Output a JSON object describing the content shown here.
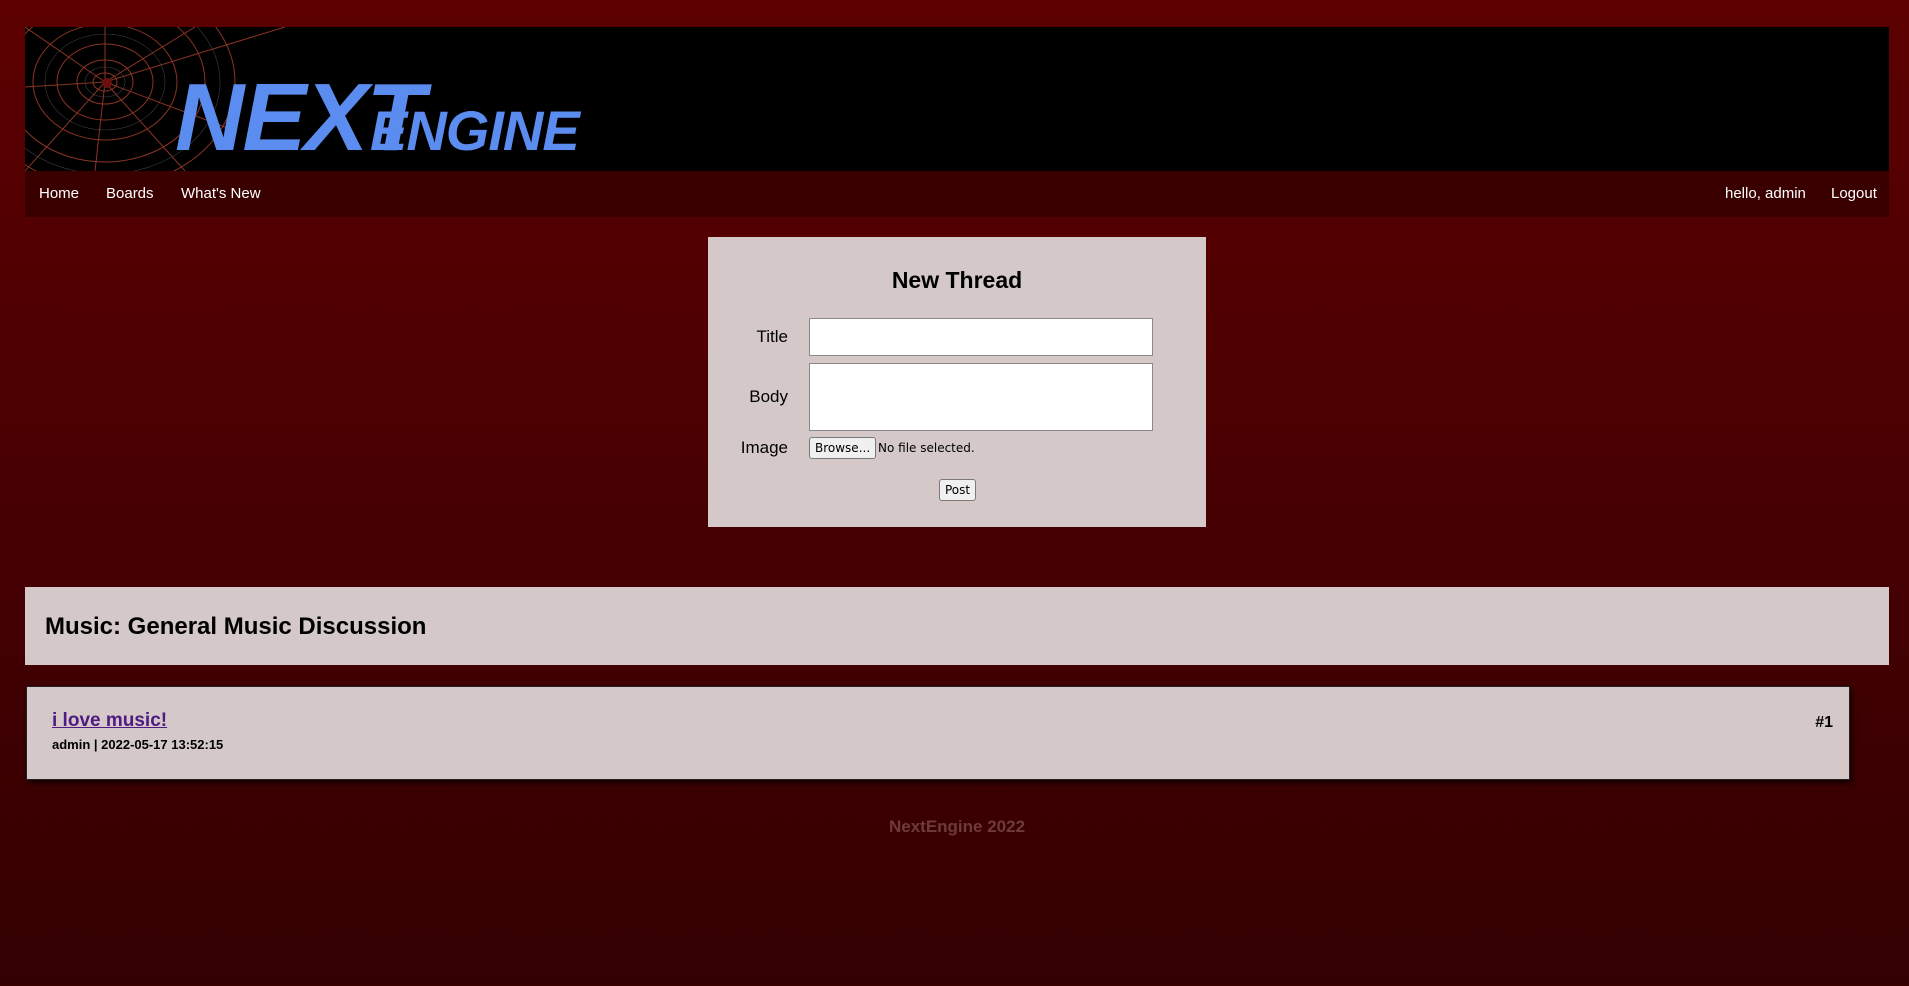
{
  "banner": {
    "logo_text_big": "NEXT",
    "logo_text_small": "ENGINE",
    "logo_color": "#5b8cf0"
  },
  "nav": {
    "home": "Home",
    "boards": "Boards",
    "whats_new": "What's New",
    "greeting": "hello, admin",
    "logout": "Logout"
  },
  "new_thread": {
    "heading": "New Thread",
    "title_label": "Title",
    "title_value": "",
    "body_label": "Body",
    "body_value": "",
    "image_label": "Image",
    "browse_button": "Browse...",
    "no_file_text": "No file selected.",
    "post_button": "Post"
  },
  "board": {
    "title": "Music: General Music Discussion"
  },
  "threads": [
    {
      "title": "i love music!",
      "meta": "admin | 2022-05-17 13:52:15",
      "number": "#1"
    }
  ],
  "footer": {
    "text": "NextEngine 2022"
  },
  "colors": {
    "background_top": "#5c0001",
    "background_bottom": "#330001",
    "navbar": "#3a0000",
    "panel": "#d4c8c8",
    "link_visited": "#4f1b82"
  }
}
